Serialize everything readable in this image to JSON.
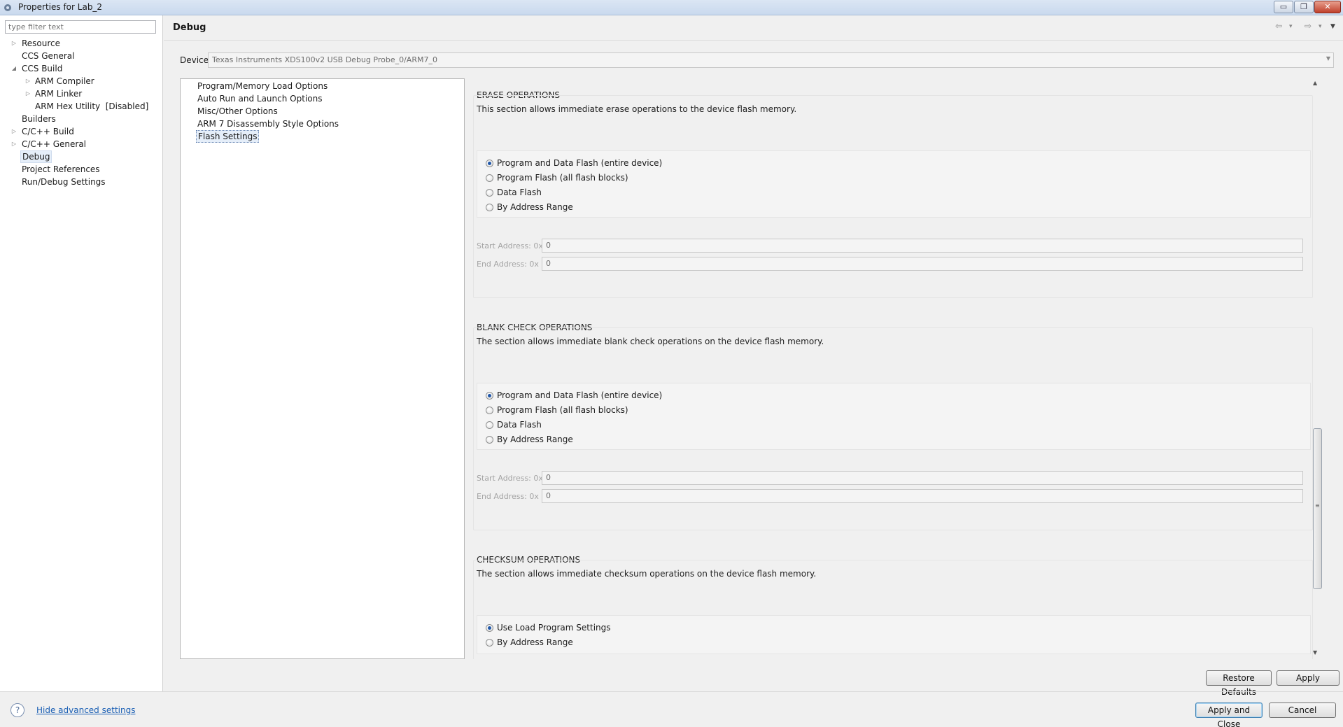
{
  "window": {
    "title": "Properties for Lab_2",
    "min_glyph": "▭",
    "max_glyph": "❐",
    "close_glyph": "✕"
  },
  "filter": {
    "placeholder": "type filter text"
  },
  "tree": [
    {
      "label": "Resource",
      "expander": "▷"
    },
    {
      "label": "CCS General",
      "expander": ""
    },
    {
      "label": "CCS Build",
      "expander": "◢"
    },
    {
      "label": "ARM Compiler",
      "expander": "▷"
    },
    {
      "label": "ARM Linker",
      "expander": "▷"
    },
    {
      "label": "ARM Hex Utility  [Disabled]",
      "expander": ""
    },
    {
      "label": "Builders",
      "expander": ""
    },
    {
      "label": "C/C++ Build",
      "expander": "▷"
    },
    {
      "label": "C/C++ General",
      "expander": "▷"
    },
    {
      "label": "Debug",
      "expander": ""
    },
    {
      "label": "Project References",
      "expander": ""
    },
    {
      "label": "Run/Debug Settings",
      "expander": ""
    }
  ],
  "header": {
    "title": "Debug",
    "back_icon": "⇦",
    "forward_icon": "⇨",
    "dropdown_icon": "▾",
    "menu_icon": "▼"
  },
  "device": {
    "label": "Device",
    "value": "Texas Instruments XDS100v2 USB Debug Probe_0/ARM7_0"
  },
  "categories": [
    "Program/Memory Load Options",
    "Auto Run and Launch Options",
    "Misc/Other Options",
    "ARM 7 Disassembly Style Options",
    "Flash Settings"
  ],
  "sections": {
    "erase": {
      "title": "ERASE OPERATIONS",
      "desc": "This section allows immediate erase operations to the device flash memory.",
      "options": [
        "Program and Data Flash (entire device)",
        "Program Flash (all flash blocks)",
        "Data Flash",
        "By Address Range"
      ],
      "start_label": "Start Address: 0x",
      "start_value": "0",
      "end_label": "End Address: 0x",
      "end_value": "0"
    },
    "blank": {
      "title": "BLANK CHECK OPERATIONS",
      "desc": "The section allows immediate blank check operations on the device flash memory.",
      "options": [
        "Program and Data Flash (entire device)",
        "Program Flash (all flash blocks)",
        "Data Flash",
        "By Address Range"
      ],
      "start_label": "Start Address: 0x",
      "start_value": "0",
      "end_label": "End Address: 0x",
      "end_value": "0"
    },
    "checksum": {
      "title": "CHECKSUM OPERATIONS",
      "desc": "The section allows immediate checksum operations on the device flash memory.",
      "options": [
        "Use Load Program Settings",
        "By Address Range"
      ]
    }
  },
  "buttons": {
    "restore_defaults": "Restore Defaults",
    "apply": "Apply",
    "apply_and_close": "Apply and Close",
    "cancel": "Cancel"
  },
  "footer": {
    "help_glyph": "?",
    "hide_advanced": "Hide advanced settings"
  }
}
